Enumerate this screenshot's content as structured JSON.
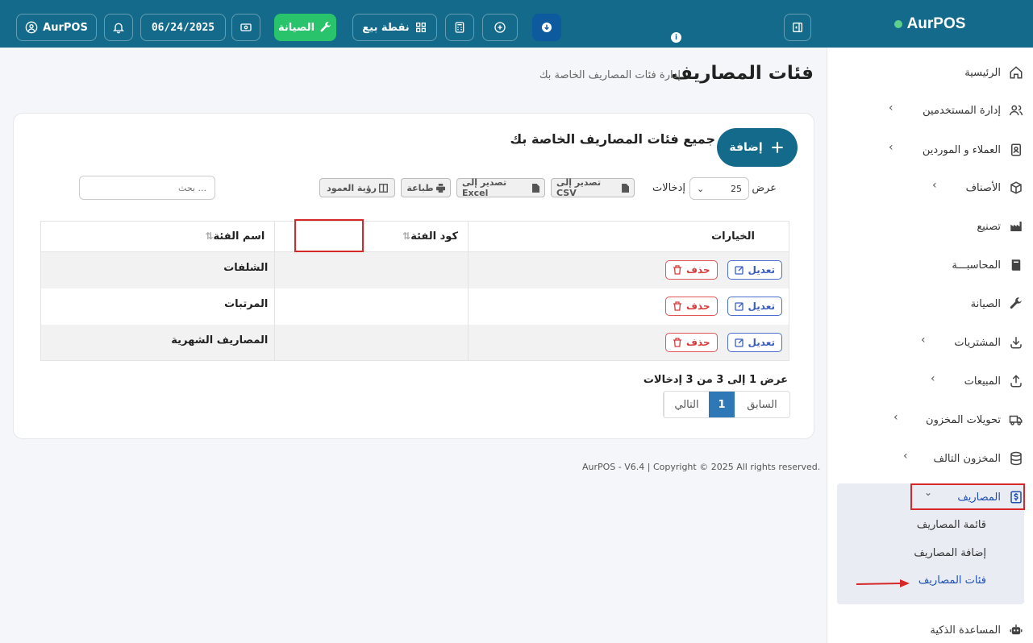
{
  "brand": {
    "name": "AurPOS"
  },
  "topbar": {
    "user": "AurPOS",
    "date": "06/24/2025",
    "maintenance": "الصيانة",
    "pos": "نقطة بيع"
  },
  "sidebar": {
    "items": [
      {
        "label": "الرئيسية"
      },
      {
        "label": "إدارة المستخدمين"
      },
      {
        "label": "العملاء و الموردين"
      },
      {
        "label": "الأصناف"
      },
      {
        "label": "تصنيع"
      },
      {
        "label": "المحاسبـــة"
      },
      {
        "label": "الصيانة"
      },
      {
        "label": "المشتريات"
      },
      {
        "label": "المبيعات"
      },
      {
        "label": "تحويلات المخزون"
      },
      {
        "label": "المخزون التالف"
      },
      {
        "label": "المصاريف"
      },
      {
        "label": "المساعدة الذكية"
      }
    ],
    "sub": [
      {
        "label": "قائمة المصاريف"
      },
      {
        "label": "إضافة المصاريف"
      },
      {
        "label": "فئات المصاريف"
      }
    ]
  },
  "page": {
    "title": "فئات المصاريف",
    "subtitle": "إدارة فئات المصاريف الخاصة بك"
  },
  "card": {
    "title": "جميع فئات المصاريف الخاصة بك",
    "add_label": "إضافة",
    "show": "عرض",
    "entries": "إدخالات",
    "page_size": "25",
    "csv": "تصدير إلى CSV",
    "excel": "تصدير إلى Excel",
    "print": "طباعة",
    "columns": "رؤية العمود",
    "search_placeholder": "بحث ..."
  },
  "table": {
    "headers": [
      "اسم الفئة",
      "كود الفئة",
      "الخيارات"
    ],
    "rows": [
      {
        "name": "الشلفات",
        "code": ""
      },
      {
        "name": "المرتبات",
        "code": ""
      },
      {
        "name": "المصاريف الشهرية",
        "code": ""
      }
    ],
    "edit": "تعديل",
    "delete": "حذف",
    "info": "عرض 1 إلى 3 من 3 إدخالات",
    "prev": "السابق",
    "page": "1",
    "next": "التالي"
  },
  "footer": "AurPOS - V6.4 | Copyright © 2025 All rights reserved."
}
